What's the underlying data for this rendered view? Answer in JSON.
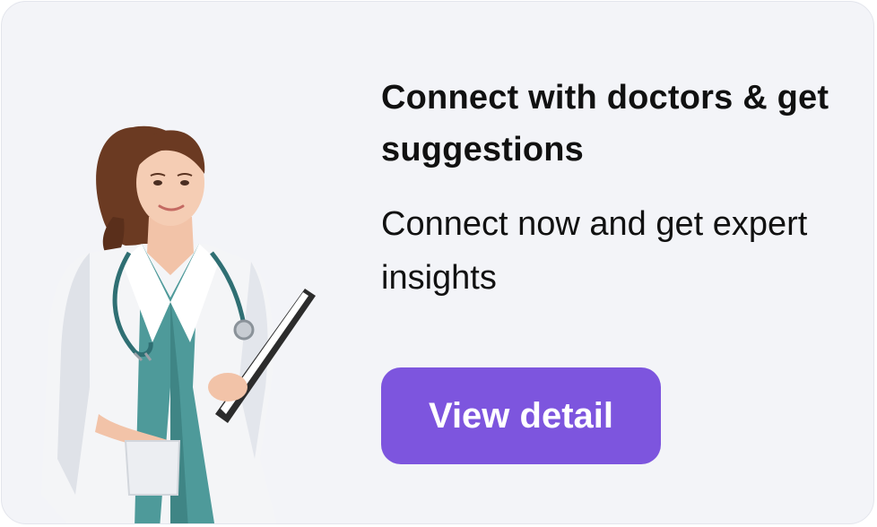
{
  "card": {
    "title": "Connect with doctors & get suggestions",
    "subtitle": "Connect now and get expert insights",
    "cta_label": "View detail"
  },
  "colors": {
    "card_background": "#f3f4f8",
    "button_background": "#7d55de",
    "button_text": "#ffffff",
    "text": "#111111"
  },
  "illustration": {
    "icon": "doctor-with-clipboard-icon"
  }
}
